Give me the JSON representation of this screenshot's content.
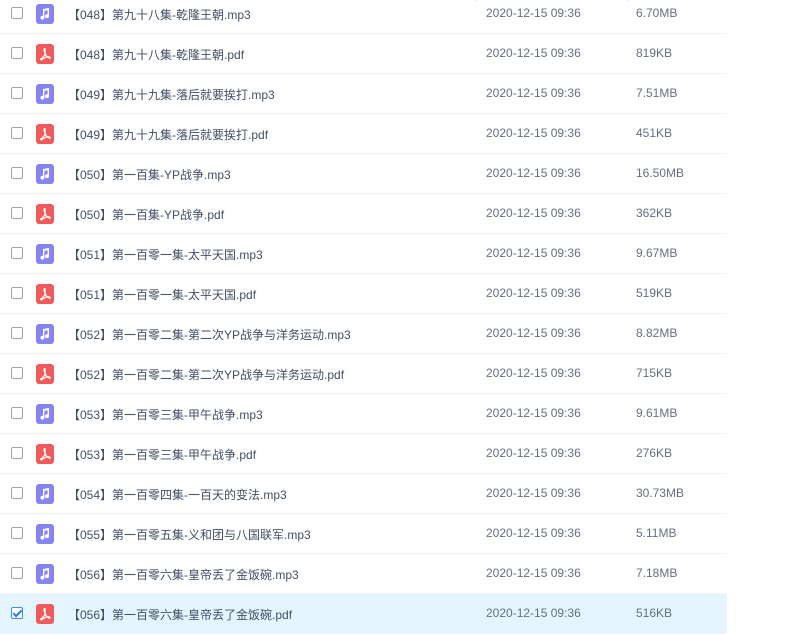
{
  "files": [
    {
      "name": "【048】第九十八集-乾隆王朝.mp3",
      "date": "2020-12-15 09:36",
      "size": "6.70MB",
      "type": "audio",
      "checked": false
    },
    {
      "name": "【048】第九十八集-乾隆王朝.pdf",
      "date": "2020-12-15 09:36",
      "size": "819KB",
      "type": "pdf",
      "checked": false
    },
    {
      "name": "【049】第九十九集-落后就要挨打.mp3",
      "date": "2020-12-15 09:36",
      "size": "7.51MB",
      "type": "audio",
      "checked": false
    },
    {
      "name": "【049】第九十九集-落后就要挨打.pdf",
      "date": "2020-12-15 09:36",
      "size": "451KB",
      "type": "pdf",
      "checked": false
    },
    {
      "name": "【050】第一百集-YP战争.mp3",
      "date": "2020-12-15 09:36",
      "size": "16.50MB",
      "type": "audio",
      "checked": false
    },
    {
      "name": "【050】第一百集-YP战争.pdf",
      "date": "2020-12-15 09:36",
      "size": "362KB",
      "type": "pdf",
      "checked": false
    },
    {
      "name": "【051】第一百零一集-太平天国.mp3",
      "date": "2020-12-15 09:36",
      "size": "9.67MB",
      "type": "audio",
      "checked": false
    },
    {
      "name": "【051】第一百零一集-太平天国.pdf",
      "date": "2020-12-15 09:36",
      "size": "519KB",
      "type": "pdf",
      "checked": false
    },
    {
      "name": "【052】第一百零二集-第二次YP战争与洋务运动.mp3",
      "date": "2020-12-15 09:36",
      "size": "8.82MB",
      "type": "audio",
      "checked": false
    },
    {
      "name": "【052】第一百零二集-第二次YP战争与洋务运动.pdf",
      "date": "2020-12-15 09:36",
      "size": "715KB",
      "type": "pdf",
      "checked": false
    },
    {
      "name": "【053】第一百零三集-甲午战争.mp3",
      "date": "2020-12-15 09:36",
      "size": "9.61MB",
      "type": "audio",
      "checked": false
    },
    {
      "name": "【053】第一百零三集-甲午战争.pdf",
      "date": "2020-12-15 09:36",
      "size": "276KB",
      "type": "pdf",
      "checked": false
    },
    {
      "name": "【054】第一百零四集-一百天的变法.mp3",
      "date": "2020-12-15 09:36",
      "size": "30.73MB",
      "type": "audio",
      "checked": false
    },
    {
      "name": "【055】第一百零五集-义和团与八国联军.mp3",
      "date": "2020-12-15 09:36",
      "size": "5.11MB",
      "type": "audio",
      "checked": false
    },
    {
      "name": "【056】第一百零六集-皇帝丢了金饭碗.mp3",
      "date": "2020-12-15 09:36",
      "size": "7.18MB",
      "type": "audio",
      "checked": false
    },
    {
      "name": "【056】第一百零六集-皇帝丢了金饭碗.pdf",
      "date": "2020-12-15 09:36",
      "size": "516KB",
      "type": "pdf",
      "checked": true
    }
  ],
  "icons": {
    "audio": "music-note-icon",
    "pdf": "pdf-icon"
  },
  "colors": {
    "audio_icon": "#8683f2",
    "pdf_icon": "#f05a5a",
    "selected_row": "#e5f5ff",
    "checkbox_checked": "#2a7ef0"
  }
}
